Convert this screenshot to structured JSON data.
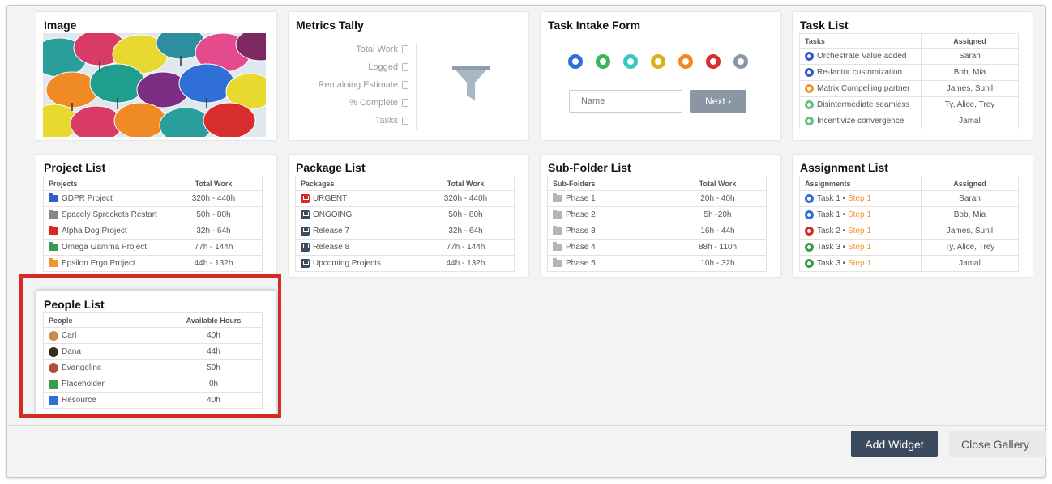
{
  "widgets": {
    "image": {
      "title": "Image"
    },
    "metrics_tally": {
      "title": "Metrics Tally",
      "metrics": [
        "Total Work",
        "Logged",
        "Remaining Estimate",
        "% Complete",
        "Tasks"
      ]
    },
    "task_intake": {
      "title": "Task Intake Form",
      "name_placeholder": "Name",
      "next_label": "Next ›",
      "dot_colors": [
        "#2f6fd6",
        "#3fb45e",
        "#3cc6c2",
        "#d9b21a",
        "#f08a24",
        "#d92e2e",
        "#8a96a3"
      ]
    },
    "task_list": {
      "title": "Task List",
      "headers": [
        "Tasks",
        "Assigned"
      ],
      "rows": [
        {
          "task": "Orchestrate Value added",
          "assigned": "Sarah",
          "color": "#2f5fc8"
        },
        {
          "task": "Re-factor customization",
          "assigned": "Bob, Mia",
          "color": "#2f5fc8"
        },
        {
          "task": "Matrix Compelling partner",
          "assigned": "James, Sunil",
          "color": "#f0962e"
        },
        {
          "task": "Disintermediate seamless",
          "assigned": "Ty, Alice, Trey",
          "color": "#6cc07f"
        },
        {
          "task": "Incentivize convergence",
          "assigned": "Jamal",
          "color": "#6cc07f"
        }
      ]
    },
    "project_list": {
      "title": "Project List",
      "headers": [
        "Projects",
        "Total Work"
      ],
      "rows": [
        {
          "name": "GDPR Project",
          "work": "320h - 440h",
          "color": "#2f5fc8"
        },
        {
          "name": "Spacely Sprockets Restart",
          "work": "50h - 80h",
          "color": "#888888"
        },
        {
          "name": "Alpha Dog Project",
          "work": "32h - 64h",
          "color": "#d32a22"
        },
        {
          "name": "Omega Gamma Project",
          "work": "77h - 144h",
          "color": "#3a9a4f"
        },
        {
          "name": "Epsilon Ergo Project",
          "work": "44h - 132h",
          "color": "#f0962e"
        }
      ]
    },
    "package_list": {
      "title": "Package List",
      "headers": [
        "Packages",
        "Total Work"
      ],
      "rows": [
        {
          "name": "URGENT",
          "work": "320h - 440h",
          "color": "#d32a22"
        },
        {
          "name": "ONGOING",
          "work": "50h - 80h",
          "color": "#3c4a5d"
        },
        {
          "name": "Release 7",
          "work": "32h - 64h",
          "color": "#3c4a5d"
        },
        {
          "name": "Release 8",
          "work": "77h - 144h",
          "color": "#3c4a5d"
        },
        {
          "name": "Upcoming Projects",
          "work": "44h - 132h",
          "color": "#3c4a5d"
        }
      ]
    },
    "subfolder_list": {
      "title": "Sub-Folder List",
      "headers": [
        "Sub-Folders",
        "Total Work"
      ],
      "rows": [
        {
          "name": "Phase 1",
          "work": "20h - 40h"
        },
        {
          "name": "Phase 2",
          "work": "5h -20h"
        },
        {
          "name": "Phase 3",
          "work": "16h - 44h"
        },
        {
          "name": "Phase 4",
          "work": "88h - 110h"
        },
        {
          "name": "Phase 5",
          "work": "10h - 32h"
        }
      ]
    },
    "assignment_list": {
      "title": "Assignment List",
      "headers": [
        "Assignments",
        "Assigned"
      ],
      "rows": [
        {
          "task": "Task 1",
          "sep": " • ",
          "step": "Step 1",
          "assigned": "Sarah",
          "color": "#2f6fd6"
        },
        {
          "task": "Task 1",
          "sep": " • ",
          "step": "Step 1",
          "assigned": "Bob, Mia",
          "color": "#2f6fd6"
        },
        {
          "task": "Task 2",
          "sep": " • ",
          "step": "Step 1",
          "assigned": "James, Sunil",
          "color": "#d32a22"
        },
        {
          "task": "Task 3",
          "sep": " • ",
          "step": "Step 1",
          "assigned": "Ty, Alice, Trey",
          "color": "#3a9a4f"
        },
        {
          "task": "Task 3",
          "sep": " • ",
          "step": "Step 1",
          "assigned": "Jamal",
          "color": "#3a9a4f"
        }
      ]
    },
    "people_list": {
      "title": "People List",
      "headers": [
        "People",
        "Available Hours"
      ],
      "rows": [
        {
          "name": "Carl",
          "hours": "40h",
          "icon": "avatar-carl-icon",
          "color": "#c98a4b"
        },
        {
          "name": "Dana",
          "hours": "44h",
          "icon": "avatar-dana-icon",
          "color": "#3a2a22"
        },
        {
          "name": "Evangeline",
          "hours": "50h",
          "icon": "avatar-evangeline-icon",
          "color": "#b44a3a"
        },
        {
          "name": "Placeholder",
          "hours": "0h",
          "icon": "placeholder-icon",
          "color": "#3a9a4f"
        },
        {
          "name": "Resource",
          "hours": "40h",
          "icon": "resource-icon",
          "color": "#2f6fd6"
        }
      ]
    }
  },
  "footer": {
    "add_widget": "Add Widget",
    "close_gallery": "Close Gallery"
  },
  "colors": {
    "highlight": "#d32a22",
    "primary_button": "#3c4a5d",
    "step_orange": "#f0962e"
  }
}
